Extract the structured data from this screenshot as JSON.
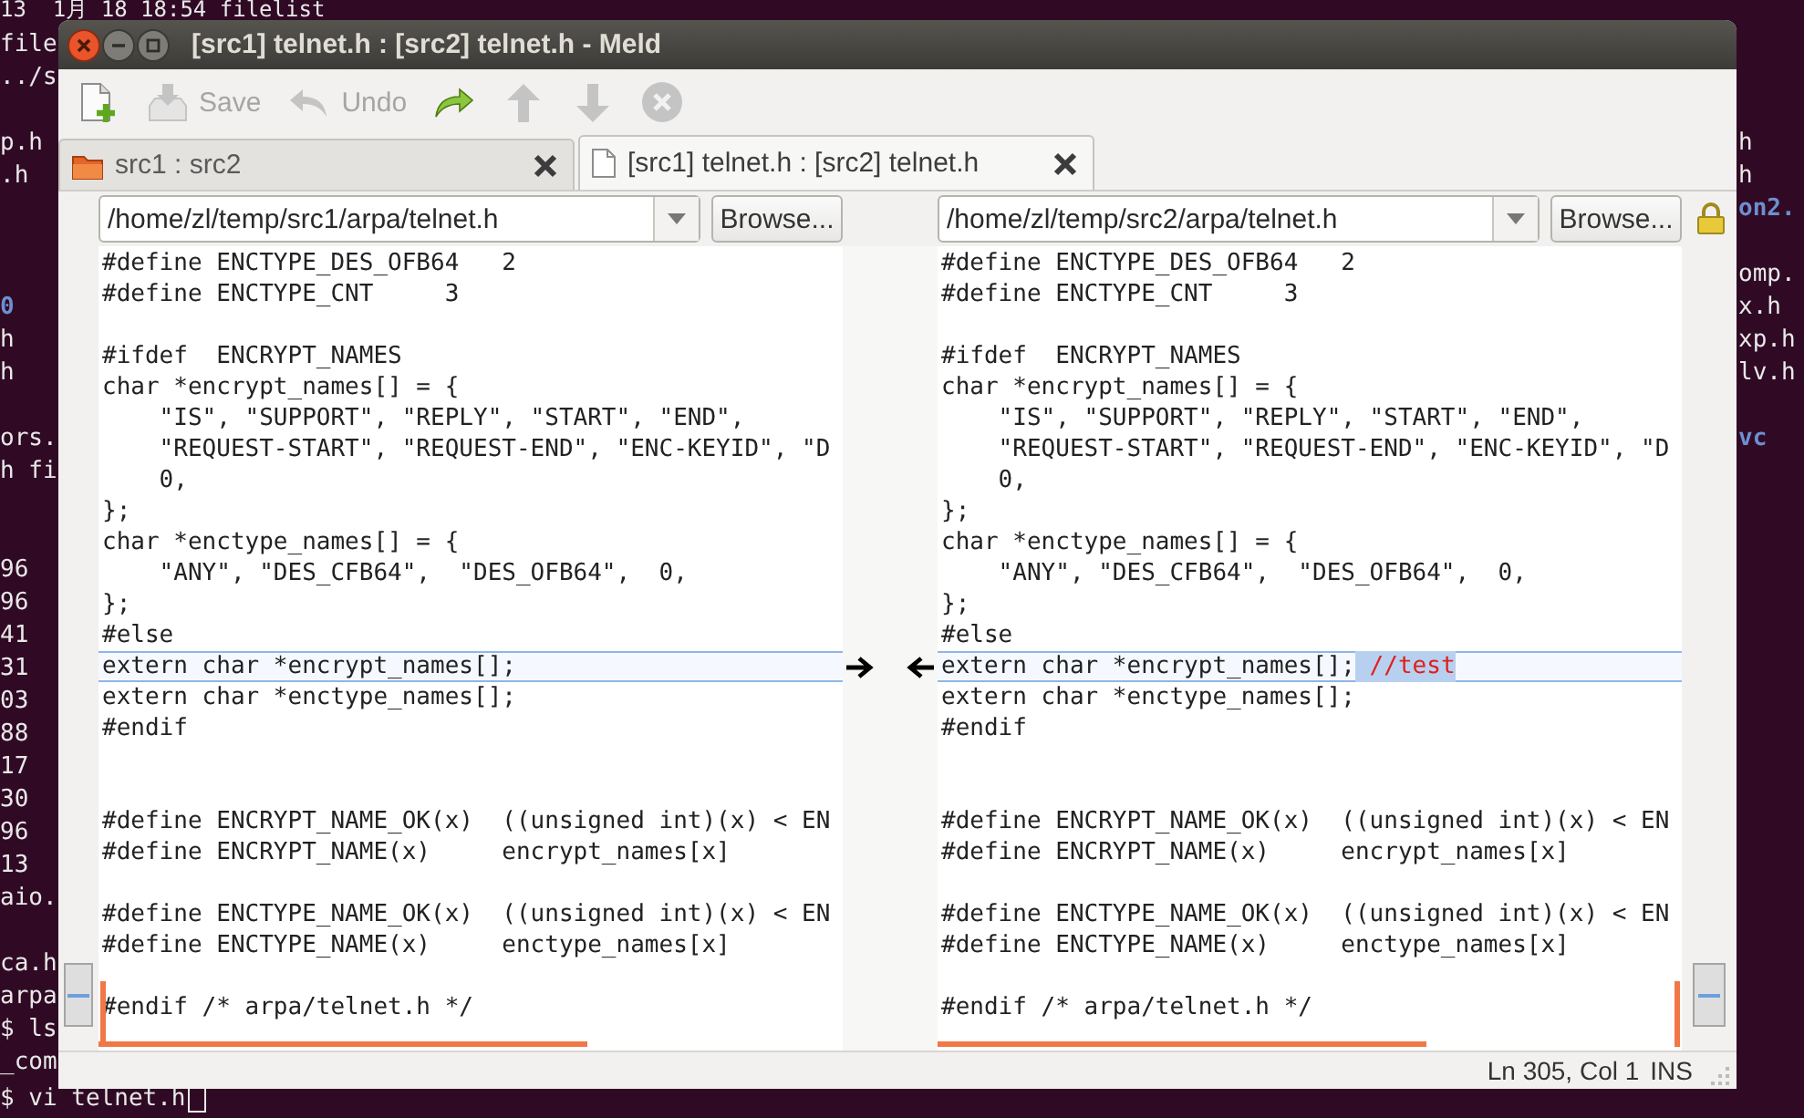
{
  "terminal": {
    "left_lines": [
      {
        "kind": "file",
        "text": "13  1月 18 18:54 filelist"
      },
      {
        "kind": "file",
        "text": "file"
      },
      {
        "kind": "file",
        "text": "../s"
      },
      {
        "kind": "blank"
      },
      {
        "kind": "file",
        "text": "p.h"
      },
      {
        "kind": "file",
        "text": ".h"
      },
      {
        "kind": "blank"
      },
      {
        "kind": "blank"
      },
      {
        "kind": "blank"
      },
      {
        "kind": "dir",
        "text": "0"
      },
      {
        "kind": "file",
        "text": "h"
      },
      {
        "kind": "file",
        "text": "h"
      },
      {
        "kind": "blank"
      },
      {
        "kind": "file",
        "text": "ors."
      },
      {
        "kind": "file",
        "text": "h fi"
      },
      {
        "kind": "blank"
      },
      {
        "kind": "blank"
      },
      {
        "kind": "file",
        "text": "96"
      },
      {
        "kind": "file",
        "text": "96"
      },
      {
        "kind": "file",
        "text": "41"
      },
      {
        "kind": "file",
        "text": "31"
      },
      {
        "kind": "file",
        "text": "03"
      },
      {
        "kind": "file",
        "text": "88"
      },
      {
        "kind": "file",
        "text": "17"
      },
      {
        "kind": "file",
        "text": "30"
      },
      {
        "kind": "file",
        "text": "96"
      },
      {
        "kind": "file",
        "text": "13"
      },
      {
        "kind": "file",
        "text": "aio."
      },
      {
        "kind": "blank"
      },
      {
        "kind": "file",
        "text": "ca.h"
      },
      {
        "kind": "file",
        "text": "arpa"
      },
      {
        "kind": "file",
        "text": "$ ls"
      },
      {
        "kind": "file",
        "text": "_com"
      },
      {
        "kind": "prompt",
        "text": "$ vi telnet.h"
      }
    ],
    "right_lines": [
      {
        "kind": "blank"
      },
      {
        "kind": "blank"
      },
      {
        "kind": "blank"
      },
      {
        "kind": "blank"
      },
      {
        "kind": "file",
        "text": "h"
      },
      {
        "kind": "file",
        "text": "h"
      },
      {
        "kind": "dir",
        "text": "on2."
      },
      {
        "kind": "blank"
      },
      {
        "kind": "file",
        "text": "omp."
      },
      {
        "kind": "file",
        "text": "x.h"
      },
      {
        "kind": "file",
        "text": "xp.h"
      },
      {
        "kind": "file",
        "text": "lv.h"
      },
      {
        "kind": "blank"
      },
      {
        "kind": "dir",
        "text": "vc"
      }
    ]
  },
  "window": {
    "title": "[src1] telnet.h : [src2] telnet.h - Meld"
  },
  "toolbar": [
    {
      "kind": "new",
      "disabled": false
    },
    {
      "kind": "save",
      "label": "Save",
      "disabled": true
    },
    {
      "kind": "undo",
      "label": "Undo",
      "disabled": true
    },
    {
      "kind": "redo",
      "disabled": false
    },
    {
      "kind": "up",
      "disabled": true
    },
    {
      "kind": "down",
      "disabled": true
    },
    {
      "kind": "stop",
      "disabled": true
    }
  ],
  "tabs": [
    {
      "kind": "folder",
      "label": "src1 : src2",
      "selected": false
    },
    {
      "kind": "file",
      "label": "[src1] telnet.h : [src2] telnet.h",
      "selected": true
    }
  ],
  "panes": [
    {
      "path": "/home/zl/temp/src1/arpa/telnet.h",
      "browse": "Browse...",
      "lines": [
        {
          "kind": "code",
          "text": "#define ENCTYPE_DES_OFB64   2",
          "changed": false
        },
        {
          "kind": "code",
          "text": "#define ENCTYPE_CNT     3",
          "changed": false
        },
        {
          "kind": "blank",
          "changed": false
        },
        {
          "kind": "code",
          "text": "#ifdef  ENCRYPT_NAMES",
          "changed": false
        },
        {
          "kind": "code",
          "text": "char *encrypt_names[] = {",
          "changed": false
        },
        {
          "kind": "code",
          "text": "    \"IS\", \"SUPPORT\", \"REPLY\", \"START\", \"END\",",
          "changed": false
        },
        {
          "kind": "code",
          "text": "    \"REQUEST-START\", \"REQUEST-END\", \"ENC-KEYID\", \"D",
          "changed": false
        },
        {
          "kind": "code",
          "text": "    0,",
          "changed": false
        },
        {
          "kind": "code",
          "text": "};",
          "changed": false
        },
        {
          "kind": "code",
          "text": "char *enctype_names[] = {",
          "changed": false
        },
        {
          "kind": "code",
          "text": "    \"ANY\", \"DES_CFB64\",  \"DES_OFB64\",  0,",
          "changed": false
        },
        {
          "kind": "code",
          "text": "};",
          "changed": false
        },
        {
          "kind": "code",
          "text": "#else",
          "changed": false
        },
        {
          "kind": "code",
          "text": "extern char *encrypt_names[];",
          "changed": true
        },
        {
          "kind": "code",
          "text": "extern char *enctype_names[];",
          "changed": false
        },
        {
          "kind": "code",
          "text": "#endif",
          "changed": false
        },
        {
          "kind": "blank",
          "changed": false
        },
        {
          "kind": "blank",
          "changed": false
        },
        {
          "kind": "code",
          "text": "#define ENCRYPT_NAME_OK(x)  ((unsigned int)(x) < EN",
          "changed": false
        },
        {
          "kind": "code",
          "text": "#define ENCRYPT_NAME(x)     encrypt_names[x]",
          "changed": false
        },
        {
          "kind": "blank",
          "changed": false
        },
        {
          "kind": "code",
          "text": "#define ENCTYPE_NAME_OK(x)  ((unsigned int)(x) < EN",
          "changed": false
        },
        {
          "kind": "code",
          "text": "#define ENCTYPE_NAME(x)     enctype_names[x]",
          "changed": false
        },
        {
          "kind": "blank",
          "changed": false
        },
        {
          "kind": "code",
          "text": "#endif /* arpa/telnet.h */",
          "changed": false
        }
      ]
    },
    {
      "path": "/home/zl/temp/src2/arpa/telnet.h",
      "browse": "Browse...",
      "lines": [
        {
          "kind": "code",
          "text": "#define ENCTYPE_DES_OFB64   2",
          "changed": false
        },
        {
          "kind": "code",
          "text": "#define ENCTYPE_CNT     3",
          "changed": false
        },
        {
          "kind": "blank",
          "changed": false
        },
        {
          "kind": "code",
          "text": "#ifdef  ENCRYPT_NAMES",
          "changed": false
        },
        {
          "kind": "code",
          "text": "char *encrypt_names[] = {",
          "changed": false
        },
        {
          "kind": "code",
          "text": "    \"IS\", \"SUPPORT\", \"REPLY\", \"START\", \"END\",",
          "changed": false
        },
        {
          "kind": "code",
          "text": "    \"REQUEST-START\", \"REQUEST-END\", \"ENC-KEYID\", \"D",
          "changed": false
        },
        {
          "kind": "code",
          "text": "    0,",
          "changed": false
        },
        {
          "kind": "code",
          "text": "};",
          "changed": false
        },
        {
          "kind": "code",
          "text": "char *enctype_names[] = {",
          "changed": false
        },
        {
          "kind": "code",
          "text": "    \"ANY\", \"DES_CFB64\",  \"DES_OFB64\",  0,",
          "changed": false
        },
        {
          "kind": "code",
          "text": "};",
          "changed": false
        },
        {
          "kind": "code",
          "text": "#else",
          "changed": false
        },
        {
          "kind": "code",
          "text": "extern char *encrypt_names[];",
          "inserted": " //test",
          "changed": true
        },
        {
          "kind": "code",
          "text": "extern char *enctype_names[];",
          "changed": false
        },
        {
          "kind": "code",
          "text": "#endif",
          "changed": false
        },
        {
          "kind": "blank",
          "changed": false
        },
        {
          "kind": "blank",
          "changed": false
        },
        {
          "kind": "code",
          "text": "#define ENCRYPT_NAME_OK(x)  ((unsigned int)(x) < EN",
          "changed": false
        },
        {
          "kind": "code",
          "text": "#define ENCRYPT_NAME(x)     encrypt_names[x]",
          "changed": false
        },
        {
          "kind": "blank",
          "changed": false
        },
        {
          "kind": "code",
          "text": "#define ENCTYPE_NAME_OK(x)  ((unsigned int)(x) < EN",
          "changed": false
        },
        {
          "kind": "code",
          "text": "#define ENCTYPE_NAME(x)     enctype_names[x]",
          "changed": false
        },
        {
          "kind": "blank",
          "changed": false
        },
        {
          "kind": "code",
          "text": "#endif /* arpa/telnet.h */",
          "changed": false
        }
      ]
    }
  ],
  "status_bar": {
    "position": "Ln 305, Col 1",
    "mode": "INS"
  }
}
